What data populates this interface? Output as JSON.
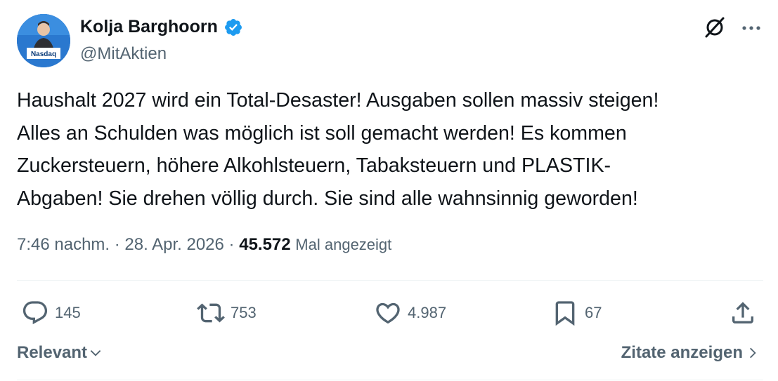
{
  "author": {
    "name": "Kolja Barghoorn",
    "handle": "@MitAktien",
    "verified": true,
    "avatar_sign_text": "Nasdaq"
  },
  "tweet": {
    "text": "Haushalt 2027 wird ein Total-Desaster! Ausgaben sollen massiv steigen!\nAlles an Schulden was möglich ist soll gemacht werden! Es kommen\nZuckersteuern, höhere Alkohlsteuern, Tabaksteuern und PLASTIK-\nAbgaben! Sie drehen völlig durch. Sie sind alle wahnsinnig geworden!"
  },
  "meta": {
    "time": "7:46 nachm.",
    "separator": " · ",
    "date": "28. Apr. 2026",
    "views_count": "45.572",
    "views_label": "Mal angezeigt"
  },
  "actions": {
    "replies": "145",
    "reposts": "753",
    "likes": "4.987",
    "bookmarks": "67"
  },
  "footer": {
    "sort_label": "Relevant",
    "quotes_label": "Zitate anzeigen"
  },
  "colors": {
    "text": "#0f1419",
    "secondary": "#536471",
    "verified_blue": "#1d9bf0",
    "divider": "#eff3f4"
  }
}
